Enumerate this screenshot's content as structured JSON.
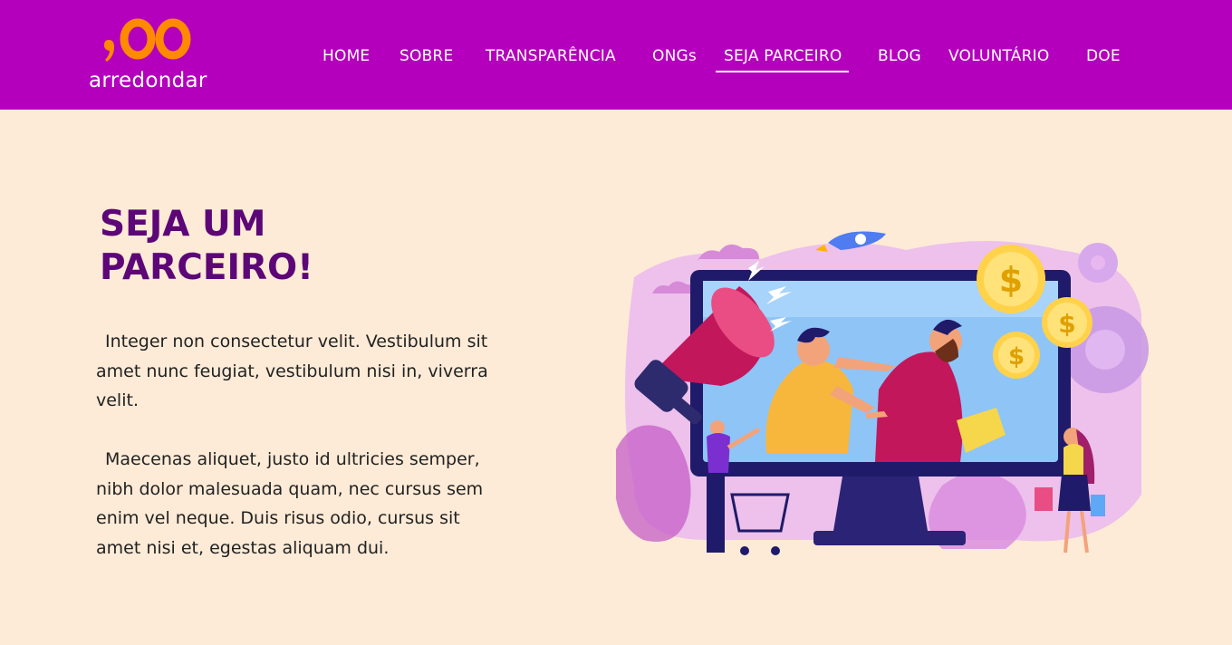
{
  "brand": {
    "mark": ",00",
    "name": "arredondar"
  },
  "nav": {
    "items": [
      {
        "label": "HOME"
      },
      {
        "label": "SOBRE"
      },
      {
        "label": "TRANSPARÊNCIA"
      },
      {
        "label": "ONGs"
      },
      {
        "label": "SEJA PARCEIRO",
        "active": true
      },
      {
        "label": "BLOG"
      },
      {
        "label": "VOLUNTÁRIO"
      },
      {
        "label": "DOE"
      }
    ]
  },
  "hero": {
    "title": "SEJA UM PARCEIRO!",
    "paragraphs": [
      "Integer non consectetur velit. Vestibulum sit amet nunc feugiat, vestibulum nisi in, viverra velit.",
      "Maecenas aliquet, justo id ultricies semper, nibh dolor malesuada quam, nec cursus sem enim vel neque. Duis risus odio, cursus sit amet nisi et, egestas aliquam dui."
    ]
  },
  "colors": {
    "header_bg": "#b400bc",
    "page_bg": "#fdebd7",
    "title": "#5c0677",
    "logo_orange": "#ff8a00"
  }
}
